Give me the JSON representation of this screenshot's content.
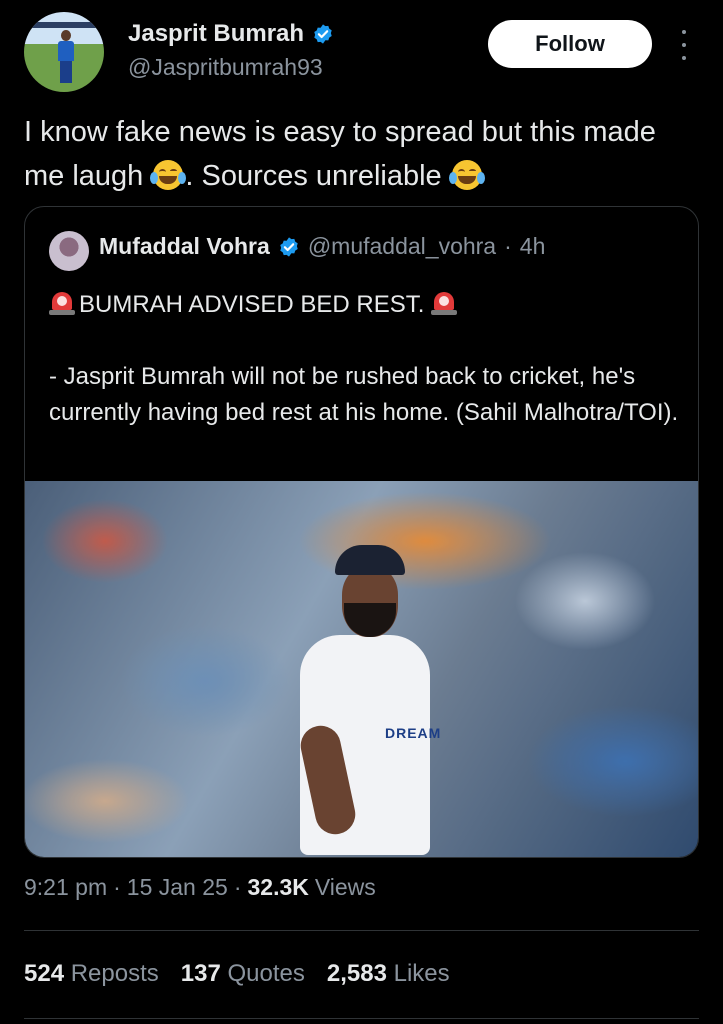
{
  "author": {
    "name": "Jasprit Bumrah",
    "handle": "@Jaspritbumrah93",
    "verified": true,
    "follow_label": "Follow"
  },
  "tweet": {
    "text_part1": "I know fake news is easy to spread but this made me laugh",
    "text_part2": ".  Sources unreliable",
    "emoji": "face-with-tears-of-joy"
  },
  "quoted": {
    "name": "Mufaddal Vohra",
    "handle": "@mufaddal_vohra",
    "separator": "·",
    "time": "4h",
    "headline": "BUMRAH ADVISED BED REST.",
    "body": "- Jasprit Bumrah will not be rushed back to cricket, he's currently having bed rest at his home. (Sahil Malhotra/TOI).",
    "headline_emoji": "police-car-light",
    "shirt_text": "DREAM"
  },
  "meta": {
    "time": "9:21 pm",
    "sep1": "·",
    "date": "15 Jan 25",
    "sep2": "·",
    "views_count": "32.3K",
    "views_label": "Views"
  },
  "stats": [
    {
      "count": "524",
      "label": "Reposts"
    },
    {
      "count": "137",
      "label": "Quotes"
    },
    {
      "count": "2,583",
      "label": "Likes"
    }
  ],
  "colors": {
    "background": "#000000",
    "text": "#e7e9ea",
    "muted": "#8b949e",
    "verified": "#1d9bf0",
    "border": "#2f3336"
  }
}
